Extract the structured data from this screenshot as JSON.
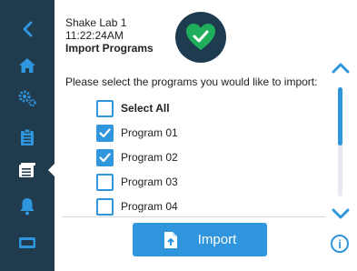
{
  "device": {
    "name": "Shake Lab 1",
    "time": "11:22:24AM",
    "screen_title": "Import Programs"
  },
  "prompt": "Please select the programs you would like to import:",
  "select_all": {
    "label": "Select All",
    "checked": false
  },
  "programs": [
    {
      "label": "Program 01",
      "checked": true
    },
    {
      "label": "Program 02",
      "checked": true
    },
    {
      "label": "Program 03",
      "checked": false
    },
    {
      "label": "Program 04",
      "checked": false
    }
  ],
  "scroll_position": 0,
  "import_button": {
    "label": "Import"
  },
  "info_button": {
    "label": "i"
  },
  "sidebar": {
    "items": [
      {
        "icon": "back-icon"
      },
      {
        "icon": "home-icon"
      },
      {
        "icon": "settings-icon"
      },
      {
        "icon": "clipboard-icon"
      },
      {
        "icon": "programs-icon",
        "active": true
      },
      {
        "icon": "bell-icon"
      },
      {
        "icon": "screen-icon"
      }
    ]
  },
  "colors": {
    "sidebar": "#203a4e",
    "accent": "#2f95dc",
    "success": "#1fae5b"
  }
}
